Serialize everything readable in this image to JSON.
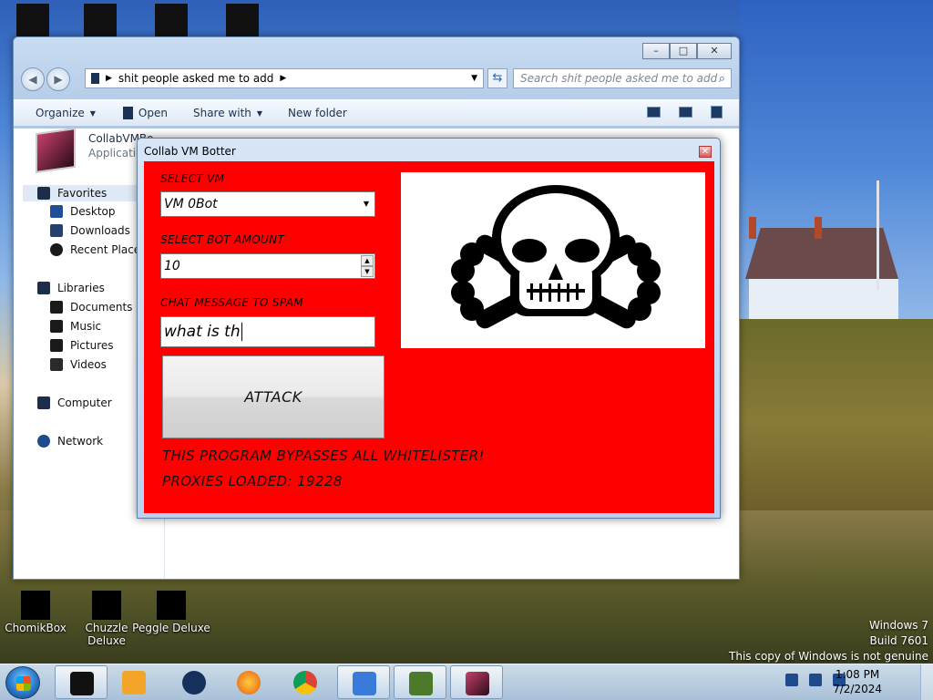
{
  "explorer": {
    "address_folder": "shit people asked me to add",
    "search_placeholder": "Search shit people asked me to add",
    "toolbar": {
      "organize": "Organize",
      "open": "Open",
      "share_with": "Share with",
      "new_folder": "New folder"
    },
    "file": {
      "name": "CollabVMBo",
      "type": "Applicatio"
    },
    "sidebar": {
      "favorites": "Favorites",
      "desktop": "Desktop",
      "downloads": "Downloads",
      "recent_places": "Recent Places",
      "libraries": "Libraries",
      "documents": "Documents",
      "music": "Music",
      "pictures": "Pictures",
      "videos": "Videos",
      "computer": "Computer",
      "network": "Network"
    }
  },
  "botter": {
    "title": "Collab VM Botter",
    "select_vm_label": "SELECT VM",
    "select_vm_value": "VM 0Bot",
    "bot_amount_label": "SELECT BOT AMOUNT",
    "bot_amount_value": "10",
    "chat_label": "CHAT MESSAGE TO SPAM",
    "chat_value": "what is th",
    "attack_label": "ATTACK",
    "bypass_text": "THIS PROGRAM BYPASSES ALL WHITELISTER!",
    "proxies_text": "PROXIES LOADED: 19228"
  },
  "desktop_icons": [
    "ChomikBox",
    "Chuzzle Deluxe",
    "Peggle Deluxe"
  ],
  "watermark": {
    "line1": "Windows 7",
    "line2": "Build 7601",
    "line3": "This copy of Windows is not genuine"
  },
  "taskbar": {
    "time": "1:08 PM",
    "date": "7/2/2024"
  },
  "colors": {
    "dialog_background": "#ff0000",
    "taskbar": "#c4d9f0"
  },
  "icons": {
    "skull": "skull-and-crossbones-icon",
    "start": "windows-start-icon"
  }
}
